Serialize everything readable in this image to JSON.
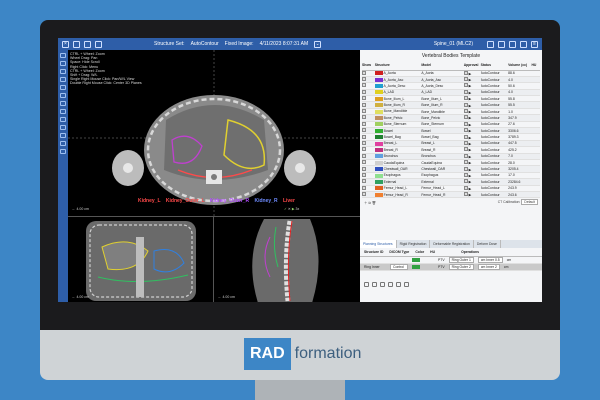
{
  "brand": {
    "rad": "RAD",
    "formation": "formation",
    "color": "#3d86c6"
  },
  "app": {
    "structure_set_label": "Structure Set:",
    "structure_set_value": "AutoContour",
    "fixed_image_label": "Fixed Image:",
    "fixed_image_value": "4/11/2023 8:07:31 AM",
    "plan_label": "Spine_01 (MLC2)"
  },
  "viewer": {
    "overlay_lines": [
      "CTRL + Wheel: Zoom",
      "Wheel Drag: Pan",
      "Space: Hide Scroll",
      "Right Click: Menu",
      "CTRL + Wheel: Zoom",
      "Shift + Drag: W/L",
      "Single Right Mouse Click: Pan/W/L View",
      "Double Right Mouse Click: Center 3D Planes"
    ],
    "structure_labels": [
      {
        "text": "Kidney_L",
        "color": "#ff4a4a"
      },
      {
        "text": "Kidney_Outer_L",
        "color": "#ff4a4a"
      },
      {
        "text": "Kidney_Outer_R",
        "color": "#b14bff"
      },
      {
        "text": "Kidney_R",
        "color": "#6f8cff"
      },
      {
        "text": "Liver",
        "color": "#ff4a4a"
      }
    ],
    "scale_axial": "← 4.00 cm",
    "scale_cor": "← 4.00 cm",
    "scale_sag": "← 4.00 cm",
    "toolbar_value": "3x"
  },
  "panel": {
    "title": "Vertebral Bodies Template",
    "headers": [
      "Show",
      "Structure",
      "Model",
      "Approval",
      "Status",
      "Volume (cc)",
      "HU"
    ],
    "rows": [
      {
        "name": "A_Aorta",
        "model": "A_Aorta",
        "status": "AutoContour",
        "volume": "88.6",
        "color": "#d02020"
      },
      {
        "name": "A_Aorta_Asc",
        "model": "A_Aorta_Asc",
        "status": "AutoContour",
        "volume": "4.0",
        "color": "#7a30d0"
      },
      {
        "name": "A_Aorta_Desc",
        "model": "A_Aorta_Desc",
        "status": "AutoContour",
        "volume": "50.6",
        "color": "#20a0d0"
      },
      {
        "name": "A_LAD",
        "model": "A_LAD",
        "status": "AutoContour",
        "volume": "4.0",
        "color": "#e0d020"
      },
      {
        "name": "Bone_Ilium_L",
        "model": "Bone_Ilium_L",
        "status": "AutoContour",
        "volume": "55.8",
        "color": "#e0a020"
      },
      {
        "name": "Bone_Ilium_R",
        "model": "Bone_Ilium_R",
        "status": "AutoContour",
        "volume": "55.5",
        "color": "#d0b040"
      },
      {
        "name": "Bone_Mandible",
        "model": "Bone_Mandible",
        "status": "AutoContour",
        "volume": "1.0",
        "color": "#e0e060"
      },
      {
        "name": "Bone_Pelvic",
        "model": "Bone_Pelvic",
        "status": "AutoContour",
        "volume": "347.9",
        "color": "#c09060"
      },
      {
        "name": "Bone_Sternum",
        "model": "Bone_Sternum",
        "status": "AutoContour",
        "volume": "27.6",
        "color": "#a0d060"
      },
      {
        "name": "Bowel",
        "model": "Bowel",
        "status": "AutoContour",
        "volume": "3306.6",
        "color": "#30b030"
      },
      {
        "name": "Bowel_Bag",
        "model": "Bowel_Bag",
        "status": "AutoContour",
        "volume": "3789.3",
        "color": "#208030"
      },
      {
        "name": "Breast_L",
        "model": "Breast_L",
        "status": "AutoContour",
        "volume": "447.5",
        "color": "#e040a0"
      },
      {
        "name": "Breast_R",
        "model": "Breast_R",
        "status": "AutoContour",
        "volume": "425.2",
        "color": "#c03080"
      },
      {
        "name": "Bronchus",
        "model": "Bronchus",
        "status": "AutoContour",
        "volume": "7.0",
        "color": "#60a0e0"
      },
      {
        "name": "CaudaEquina",
        "model": "CaudaEquina",
        "status": "AutoContour",
        "volume": "28.0",
        "color": "#d0d0d0"
      },
      {
        "name": "Chestwall_OAR",
        "model": "Chestwall_OAR",
        "status": "AutoContour",
        "volume": "3205.4",
        "color": "#3050c0"
      },
      {
        "name": "Esophagus",
        "model": "Esophagus",
        "status": "AutoContour",
        "volume": "17.0",
        "color": "#90e090"
      },
      {
        "name": "External",
        "model": "External",
        "status": "AutoContour",
        "volume": "23284.6",
        "color": "#30a060"
      },
      {
        "name": "Femur_Head_L",
        "model": "Femur_Head_L",
        "status": "AutoContour",
        "volume": "243.9",
        "color": "#e06020"
      },
      {
        "name": "Femur_Head_R",
        "model": "Femur_Head_R",
        "status": "AutoContour",
        "volume": "243.6",
        "color": "#f08030"
      }
    ],
    "ct_calibration_label": "CT Calibration:",
    "ct_calibration_value": "Default",
    "tabs": [
      "Planning Structures",
      "Rigid Registration",
      "Deformable Registration",
      "Deform Dose"
    ],
    "sub_headers": [
      "Structure ID",
      "DICOM Type",
      "Color",
      "HU",
      "Operations"
    ],
    "sub_rows": [
      {
        "id": "",
        "type": "",
        "op_label": "PTV",
        "op1": "Ring Outer 1",
        "op2": "cm Inner 0.5",
        "op3": "cm"
      },
      {
        "id": "Ring Inner",
        "type": "Control",
        "op_label": "PTV",
        "op1": "Ring Outer 2",
        "op2": "cm Inner 2",
        "op3": "cm"
      }
    ]
  }
}
